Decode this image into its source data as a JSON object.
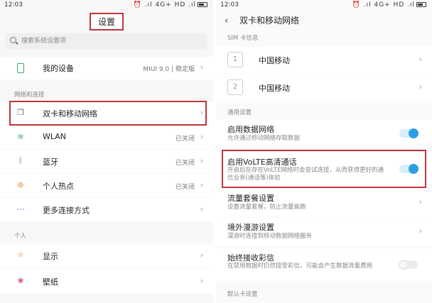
{
  "left": {
    "status": {
      "time": "12:03",
      "icons": "⏰ .ıl 4G+ HD .ıl"
    },
    "title": "设置",
    "search_placeholder": "搜索系统设置项",
    "my_device": {
      "label": "我的设备",
      "value": "MIUI 9.0 | 稳定版"
    },
    "section_network": "网络和连接",
    "items": [
      {
        "label": "双卡和移动网络",
        "value": ""
      },
      {
        "label": "WLAN",
        "value": "已关闭"
      },
      {
        "label": "蓝牙",
        "value": "已关闭"
      },
      {
        "label": "个人热点",
        "value": "已关闭"
      },
      {
        "label": "更多连接方式",
        "value": ""
      }
    ],
    "section_personal": "个人",
    "personal_items": [
      {
        "label": "显示"
      },
      {
        "label": "壁纸"
      }
    ]
  },
  "right": {
    "status": {
      "time": "12:03",
      "icons": "⏰ .ıl 4G+ HD .ıl"
    },
    "title": "双卡和移动网络",
    "section_sim": "SIM 卡信息",
    "sims": [
      {
        "num": "1",
        "name": "中国移动"
      },
      {
        "num": "2",
        "name": "中国移动"
      }
    ],
    "section_general": "通用设置",
    "settings": [
      {
        "title": "启用数据网络",
        "desc": "允许通过移动网络存取数据",
        "control": "toggle-on"
      },
      {
        "title": "启用VoLTE高清通话",
        "desc": "开启后在存在VoLTE网络时会尝试连接，从而获得更好的通信业务(通话等)体验",
        "control": "toggle-on"
      },
      {
        "title": "流量套餐设置",
        "desc": "设置流量套餐，防止流量偷跑",
        "control": "chevron"
      },
      {
        "title": "境外漫游设置",
        "desc": "漫游时连接到移动数据网络服务",
        "control": "chevron"
      },
      {
        "title": "始终接收彩信",
        "desc": "在禁用数据时仍然接受彩信，可能会产生数据流量费用",
        "control": "toggle-off"
      }
    ],
    "section_default": "默认卡设置"
  },
  "colors": {
    "highlight": "#c0343a",
    "toggle_on": "#2b9de6"
  }
}
